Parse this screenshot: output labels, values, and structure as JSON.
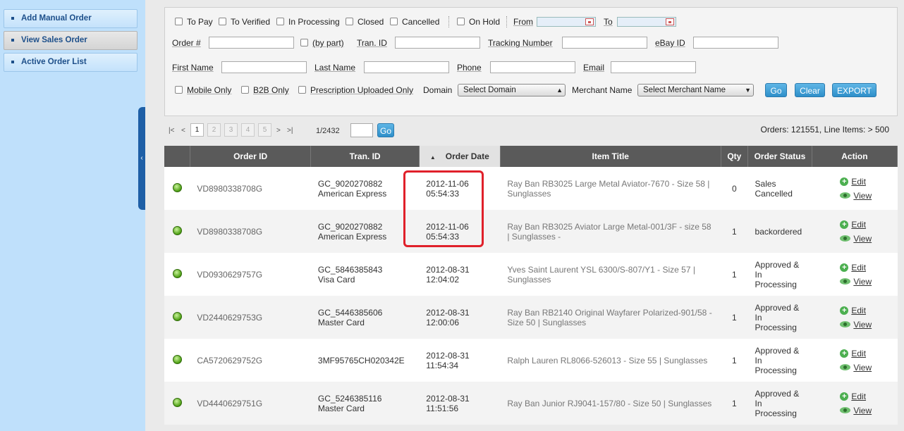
{
  "sidebar": {
    "items": [
      {
        "label": "Add Manual Order"
      },
      {
        "label": "View Sales Order"
      },
      {
        "label": "Active Order List"
      }
    ],
    "collapse_glyph": "‹"
  },
  "filters": {
    "status": [
      "To Pay",
      "To Verified",
      "In Processing",
      "Closed",
      "Cancelled"
    ],
    "on_hold": "On Hold",
    "from": "From",
    "to": "To",
    "order_no": "Order #",
    "by_part": "(by part)",
    "tran_id": "Tran. ID",
    "tracking": "Tracking Number",
    "ebay_id": "eBay ID",
    "first_name": "First Name",
    "last_name": "Last Name",
    "phone": "Phone",
    "email": "Email",
    "mobile_only": "Mobile Only",
    "b2b_only": "B2B Only",
    "prescription": "Prescription Uploaded Only",
    "domain": "Domain",
    "domain_select": "Select Domain",
    "merchant": "Merchant Name",
    "merchant_select": "Select Merchant Name",
    "go": "Go",
    "clear": "Clear",
    "export": "EXPORT"
  },
  "pager": {
    "first": "|<",
    "prev": "<",
    "pages": [
      "1",
      "2",
      "3",
      "4",
      "5"
    ],
    "next": ">",
    "last": ">|",
    "page_info": "1/2432",
    "go": "Go",
    "summary": "Orders: 121551, Line Items: > 500"
  },
  "table": {
    "headers": [
      "Order ID",
      "Tran. ID",
      "Order Date",
      "Item Title",
      "Qty",
      "Order Status",
      "Action"
    ],
    "sort_glyph": "▲",
    "edit_label": "Edit",
    "view_label": "View",
    "rows": [
      {
        "order_id": "VD8980338708G",
        "tran_id": "GC_9020270882",
        "payment": "American Express",
        "date": "2012-11-06",
        "time": "05:54:33",
        "title": "Ray Ban RB3025 Large Metal Aviator-7670 - Size 58 | Sunglasses",
        "qty": "0",
        "status": "Sales Cancelled"
      },
      {
        "order_id": "VD8980338708G",
        "tran_id": "GC_9020270882",
        "payment": "American Express",
        "date": "2012-11-06",
        "time": "05:54:33",
        "title": "Ray Ban RB3025 Aviator Large Metal-001/3F - size 58 | Sunglasses -",
        "qty": "1",
        "status": "backordered"
      },
      {
        "order_id": "VD0930629757G",
        "tran_id": "GC_5846385843",
        "payment": "Visa Card",
        "date": "2012-08-31",
        "time": "12:04:02",
        "title": "Yves Saint Laurent YSL 6300/S-807/Y1 - Size 57 | Sunglasses",
        "qty": "1",
        "status": "Approved & In Processing"
      },
      {
        "order_id": "VD2440629753G",
        "tran_id": "GC_5446385606",
        "payment": "Master Card",
        "date": "2012-08-31",
        "time": "12:00:06",
        "title": "Ray Ban RB2140 Original Wayfarer Polarized-901/58 - Size 50 | Sunglasses",
        "qty": "1",
        "status": "Approved & In Processing"
      },
      {
        "order_id": "CA5720629752G",
        "tran_id": "3MF95765CH020342E",
        "payment": "",
        "date": "2012-08-31",
        "time": "11:54:34",
        "title": "Ralph Lauren RL8066-526013 - Size 55 | Sunglasses",
        "qty": "1",
        "status": "Approved & In Processing"
      },
      {
        "order_id": "VD4440629751G",
        "tran_id": "GC_5246385116",
        "payment": "Master Card",
        "date": "2012-08-31",
        "time": "11:51:56",
        "title": "Ray Ban Junior RJ9041-157/80 - Size 50 | Sunglasses",
        "qty": "1",
        "status": "Approved & In Processing"
      }
    ]
  },
  "colors": {
    "sidebar_bg": "#bfe0fb",
    "header_bg": "#5a5a5a",
    "button_blue": "#2e8fc9",
    "highlight_red": "#e0202a"
  }
}
